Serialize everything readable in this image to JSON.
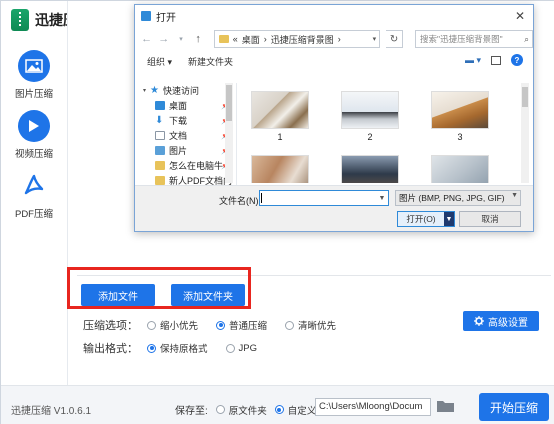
{
  "app": {
    "name": "迅捷压缩",
    "version": "迅捷压缩 V1.0.6.1",
    "sidebar": [
      {
        "label": "图片压缩",
        "icon": "image-icon"
      },
      {
        "label": "视频压缩",
        "icon": "play-icon"
      },
      {
        "label": "PDF压缩",
        "icon": "pdf-icon"
      }
    ],
    "add_file": "添加文件",
    "add_folder": "添加文件夹",
    "compress_label": "压缩选项：",
    "compress_options": [
      "缩小优先",
      "普通压缩",
      "清晰优先"
    ],
    "compress_selected": "普通压缩",
    "format_label": "输出格式：",
    "format_options": [
      "保持原格式",
      "JPG"
    ],
    "format_selected": "保持原格式",
    "advanced": "高级设置",
    "save_to": "保存至:",
    "save_options": [
      "原文件夹",
      "自定义"
    ],
    "save_selected": "自定义",
    "path": "C:\\Users\\Mloong\\Docum",
    "start": "开始压缩",
    "accent": "#1e74e8",
    "highlight": "#e8261f"
  },
  "dialog": {
    "title": "打开",
    "close": "✕",
    "breadcrumb": [
      "«",
      "桌面",
      "›",
      "迅捷压缩背景图",
      "›"
    ],
    "search_placeholder": "搜索\"迅捷压缩背景图\"",
    "organize": "组织 ▾",
    "new_folder": "新建文件夹",
    "nav_items": [
      {
        "label": "快速访问",
        "icon": "star-icon",
        "head": true
      },
      {
        "label": "桌面",
        "icon": "desktop-icon",
        "pin": true
      },
      {
        "label": "下载",
        "icon": "download-icon",
        "pin": true
      },
      {
        "label": "文档",
        "icon": "document-icon",
        "pin": true
      },
      {
        "label": "图片",
        "icon": "picture-icon",
        "pin": true
      },
      {
        "label": "怎么在电脑牛",
        "icon": "folder-icon",
        "pin": true
      },
      {
        "label": "新人PDF文档内",
        "icon": "folder-icon",
        "pin": false
      }
    ],
    "thumbnails": [
      "1",
      "2",
      "3",
      "",
      "",
      ""
    ],
    "filename_label": "文件名(N):",
    "filename_value": "",
    "filter": "图片 (BMP, PNG, JPG, GIF)",
    "open": "打开(O)",
    "cancel": "取消"
  }
}
